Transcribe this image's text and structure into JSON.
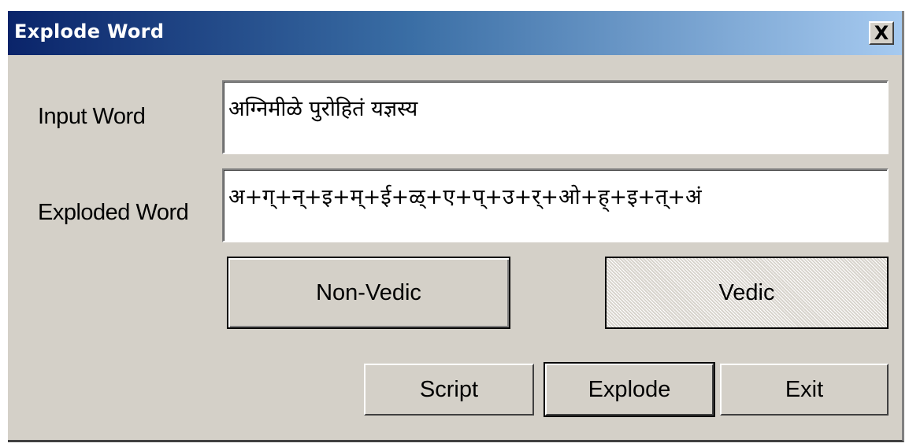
{
  "window": {
    "title": "Explode Word",
    "close_label": "X"
  },
  "form": {
    "input_label": "Input Word",
    "input_value": "अग्निमीळे पुरोहितं यज्ञस्य",
    "exploded_label": "Exploded Word",
    "exploded_value": "अ+ग्+न्+इ+म्+ई+ळ्+ए+प्+उ+र्+ओ+ह्+इ+त्+अं"
  },
  "mode_buttons": {
    "non_vedic_label": "Non-Vedic",
    "vedic_label": "Vedic"
  },
  "actions": {
    "script_label": "Script",
    "explode_label": "Explode",
    "exit_label": "Exit"
  },
  "colors": {
    "titlebar_start": "#0a246a",
    "titlebar_end": "#a6caf0",
    "face": "#d4d0c8"
  }
}
